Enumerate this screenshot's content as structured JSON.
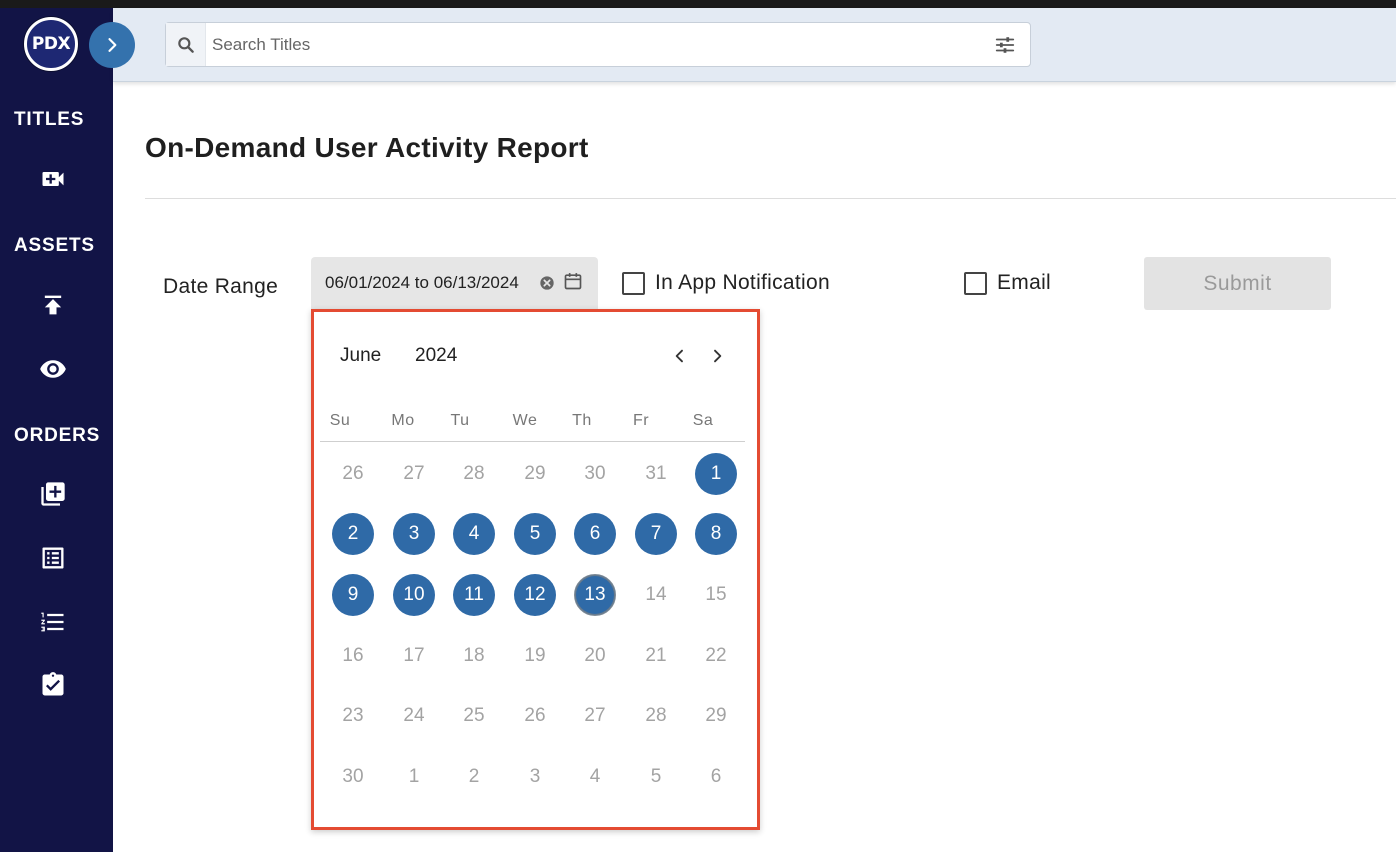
{
  "app": {
    "logo_text": "PDX"
  },
  "sidebar": {
    "sections": [
      {
        "label": "TITLES"
      },
      {
        "label": "ASSETS"
      },
      {
        "label": "ORDERS"
      }
    ],
    "icons": [
      "video-add-icon",
      "upload-icon",
      "eye-icon",
      "library-add-icon",
      "list-alt-icon",
      "format-list-numbered-icon",
      "assignment-turned-in-icon"
    ]
  },
  "search": {
    "placeholder": "Search Titles",
    "value": ""
  },
  "page": {
    "title": "On-Demand User Activity Report"
  },
  "form": {
    "date_range_label": "Date Range",
    "date_range_value": "06/01/2024 to 06/13/2024",
    "in_app_notification_label": "In App Notification",
    "email_label": "Email",
    "submit_label": "Submit"
  },
  "calendar": {
    "month": "June",
    "year": "2024",
    "weekdays": [
      "Su",
      "Mo",
      "Tu",
      "We",
      "Th",
      "Fr",
      "Sa"
    ],
    "weeks": [
      [
        {
          "d": "26",
          "s": ""
        },
        {
          "d": "27",
          "s": ""
        },
        {
          "d": "28",
          "s": ""
        },
        {
          "d": "29",
          "s": ""
        },
        {
          "d": "30",
          "s": ""
        },
        {
          "d": "31",
          "s": ""
        },
        {
          "d": "1",
          "s": "sel"
        }
      ],
      [
        {
          "d": "2",
          "s": "sel"
        },
        {
          "d": "3",
          "s": "sel"
        },
        {
          "d": "4",
          "s": "sel"
        },
        {
          "d": "5",
          "s": "sel"
        },
        {
          "d": "6",
          "s": "sel"
        },
        {
          "d": "7",
          "s": "sel"
        },
        {
          "d": "8",
          "s": "sel"
        }
      ],
      [
        {
          "d": "9",
          "s": "sel"
        },
        {
          "d": "10",
          "s": "sel"
        },
        {
          "d": "11",
          "s": "sel"
        },
        {
          "d": "12",
          "s": "sel"
        },
        {
          "d": "13",
          "s": "end"
        },
        {
          "d": "14",
          "s": ""
        },
        {
          "d": "15",
          "s": ""
        }
      ],
      [
        {
          "d": "16",
          "s": ""
        },
        {
          "d": "17",
          "s": ""
        },
        {
          "d": "18",
          "s": ""
        },
        {
          "d": "19",
          "s": ""
        },
        {
          "d": "20",
          "s": ""
        },
        {
          "d": "21",
          "s": ""
        },
        {
          "d": "22",
          "s": ""
        }
      ],
      [
        {
          "d": "23",
          "s": ""
        },
        {
          "d": "24",
          "s": ""
        },
        {
          "d": "25",
          "s": ""
        },
        {
          "d": "26",
          "s": ""
        },
        {
          "d": "27",
          "s": ""
        },
        {
          "d": "28",
          "s": ""
        },
        {
          "d": "29",
          "s": ""
        }
      ],
      [
        {
          "d": "30",
          "s": ""
        },
        {
          "d": "1",
          "s": ""
        },
        {
          "d": "2",
          "s": ""
        },
        {
          "d": "3",
          "s": ""
        },
        {
          "d": "4",
          "s": ""
        },
        {
          "d": "5",
          "s": ""
        },
        {
          "d": "6",
          "s": ""
        }
      ]
    ]
  },
  "colors": {
    "sidebar": "#121446",
    "accent": "#2f6aa7",
    "highlight_border": "#e44b32"
  }
}
